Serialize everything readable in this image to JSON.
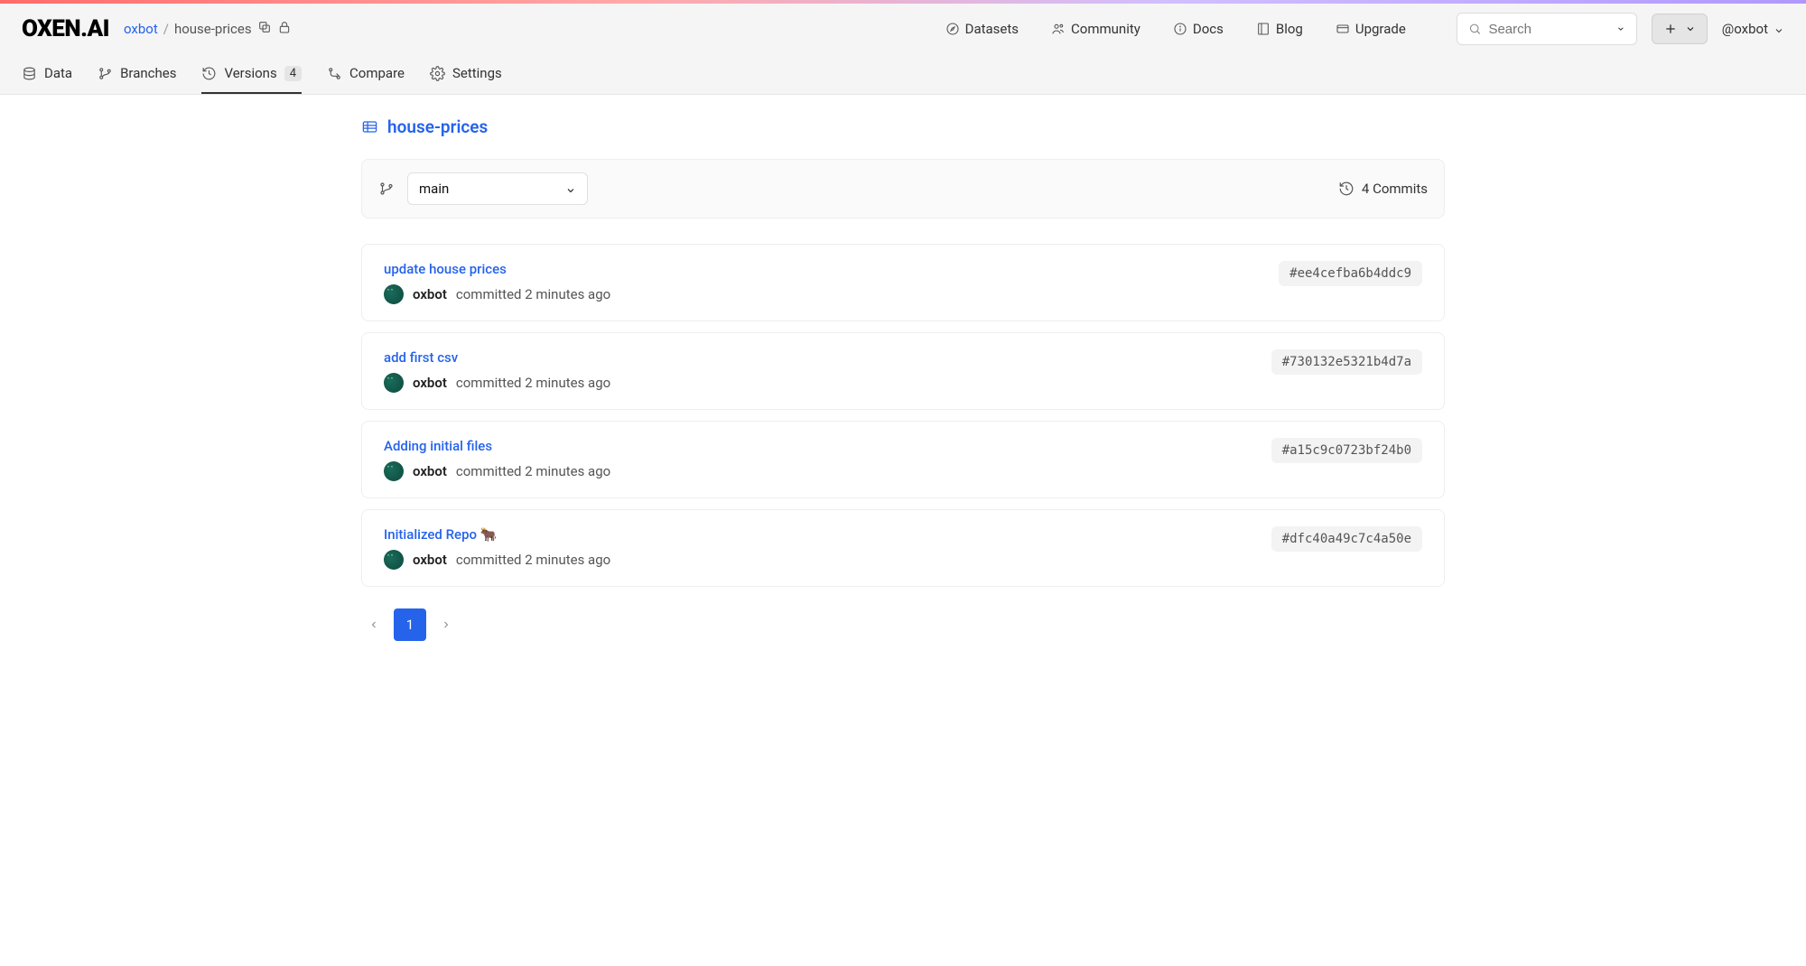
{
  "brand": "OXEN.AI",
  "breadcrumb": {
    "owner": "oxbot",
    "sep": "/",
    "repo": "house-prices"
  },
  "topnav": {
    "datasets": "Datasets",
    "community": "Community",
    "docs": "Docs",
    "blog": "Blog",
    "upgrade": "Upgrade"
  },
  "search": {
    "placeholder": "Search"
  },
  "user": {
    "handle": "@oxbot"
  },
  "tabs": {
    "data": "Data",
    "branches": "Branches",
    "versions": "Versions",
    "versions_count": "4",
    "compare": "Compare",
    "settings": "Settings"
  },
  "repo_title": "house-prices",
  "branch_selector": {
    "value": "main"
  },
  "commits_label": "4 Commits",
  "commits": [
    {
      "message": "update house prices",
      "author": "oxbot",
      "action": "committed 2 minutes ago",
      "hash": "#ee4cefba6b4ddc9"
    },
    {
      "message": "add first csv",
      "author": "oxbot",
      "action": "committed 2 minutes ago",
      "hash": "#730132e5321b4d7a"
    },
    {
      "message": "Adding initial files",
      "author": "oxbot",
      "action": "committed 2 minutes ago",
      "hash": "#a15c9c0723bf24b0"
    },
    {
      "message": "Initialized Repo 🐂",
      "author": "oxbot",
      "action": "committed 2 minutes ago",
      "hash": "#dfc40a49c7c4a50e"
    }
  ],
  "pagination": {
    "current": "1"
  }
}
